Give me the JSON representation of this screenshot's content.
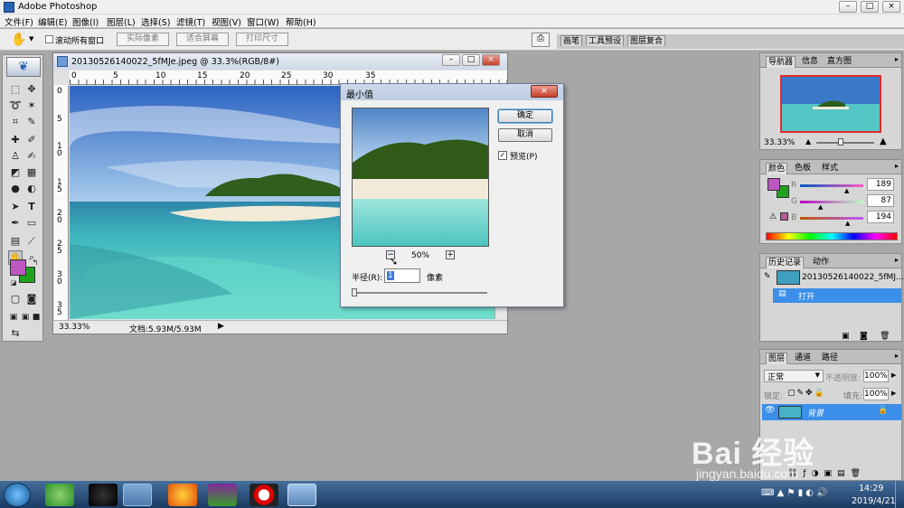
{
  "app": {
    "title": "Adobe Photoshop",
    "win_buttons": [
      "–",
      "□",
      "×"
    ]
  },
  "menu": [
    "文件(F)",
    "编辑(E)",
    "图像(I)",
    "图层(L)",
    "选择(S)",
    "滤镜(T)",
    "视图(V)",
    "窗口(W)",
    "帮助(H)"
  ],
  "options_bar": {
    "scroll_all_label": "滚动所有窗口",
    "buttons": [
      "实际像素",
      "适合屏幕",
      "打印尺寸"
    ],
    "palette_well": [
      "画笔",
      "工具预设",
      "图层复合"
    ]
  },
  "document": {
    "title": "20130526140022_5fMJe.jpeg @ 33.3%(RGB/8#)",
    "ruler_top": [
      "0",
      "5",
      "10",
      "15",
      "20",
      "25",
      "30",
      "35"
    ],
    "ruler_left": [
      "0",
      "5",
      "1 0",
      "1 5",
      "2 0",
      "2 5",
      "3 0",
      "3 5"
    ],
    "zoom": "33.33%",
    "doc_size": "文档:5.93M/5.93M"
  },
  "dialog": {
    "title": "最小值",
    "ok": "确定",
    "cancel": "取消",
    "preview_label": "预览(P)",
    "preview_checked": true,
    "zoom": "50%",
    "radius_label": "半径(R):",
    "radius_value": "1",
    "radius_unit": "像素"
  },
  "navigator": {
    "tabs": [
      "导航器",
      "信息",
      "直方图"
    ],
    "zoom": "33.33%"
  },
  "color_panel": {
    "tabs": [
      "颜色",
      "色板",
      "样式"
    ],
    "channels": [
      {
        "label": "R",
        "value": "189"
      },
      {
        "label": "G",
        "value": "87"
      },
      {
        "label": "B",
        "value": "194"
      }
    ],
    "fg_color": "#bd57c2",
    "bg_color": "#1fa31f"
  },
  "history": {
    "tabs": [
      "历史记录",
      "动作"
    ],
    "snapshot": "20130526140022_5fMJ...",
    "step": "打开"
  },
  "layers": {
    "tabs": [
      "图层",
      "通道",
      "路径"
    ],
    "blend_mode": "正常",
    "opacity_label": "不透明度:",
    "opacity": "100%",
    "lock_label": "锁定:",
    "fill_label": "填充:",
    "fill": "100%",
    "layer_name": "背景"
  },
  "taskbar": {
    "time": "14:29",
    "date": "2019/4/21"
  },
  "watermark": {
    "line1": "Bai  经验",
    "line2": "jingyan.baidu.com"
  }
}
